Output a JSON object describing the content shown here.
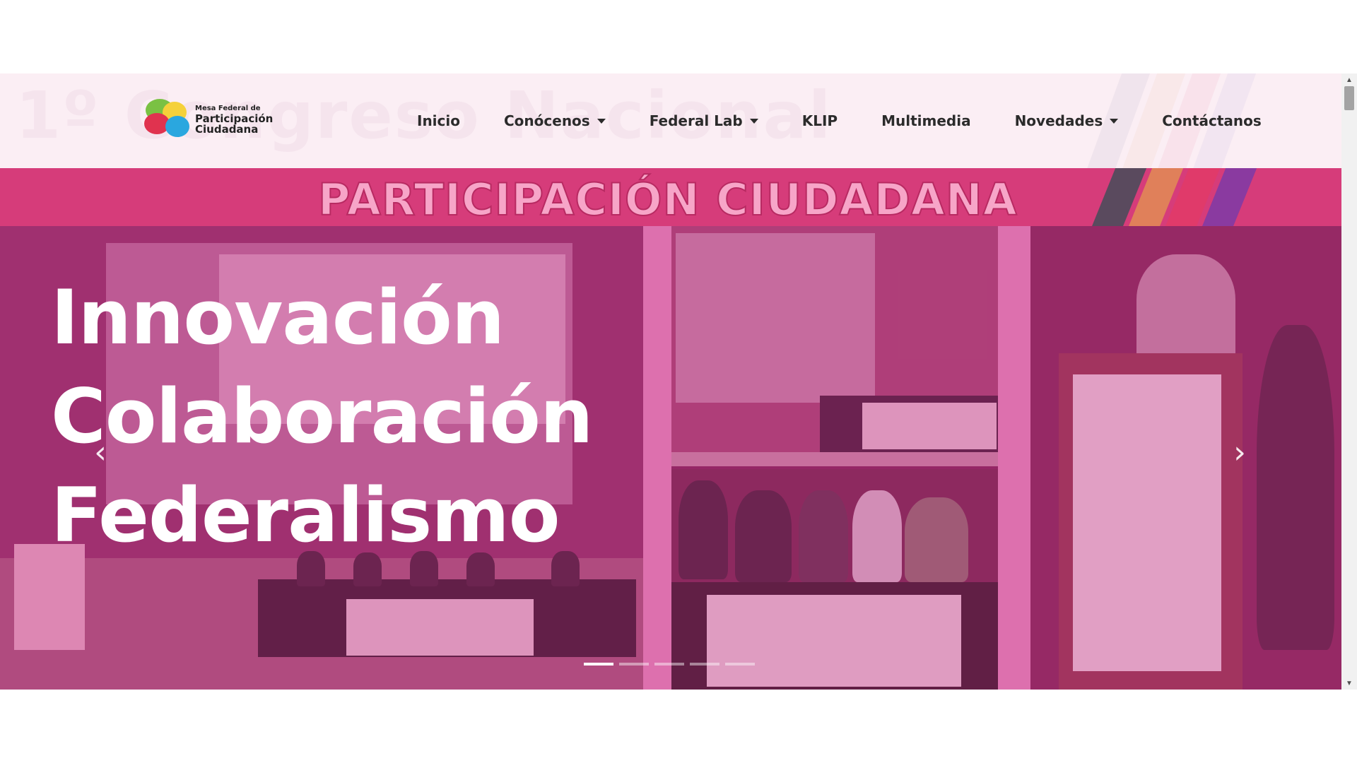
{
  "logo": {
    "line1": "Mesa Federal de",
    "line2": "Participación",
    "line3": "Ciudadana"
  },
  "header_ghost_text": "1º Congreso Nacional",
  "nav": {
    "items": [
      {
        "label": "Inicio",
        "dropdown": false
      },
      {
        "label": "Conócenos",
        "dropdown": true
      },
      {
        "label": "Federal Lab",
        "dropdown": true
      },
      {
        "label": "KLIP",
        "dropdown": false
      },
      {
        "label": "Multimedia",
        "dropdown": false
      },
      {
        "label": "Novedades",
        "dropdown": true
      },
      {
        "label": "Contáctanos",
        "dropdown": false
      }
    ]
  },
  "banner": {
    "title": "PARTICIPACIÓN CIUDADANA"
  },
  "carousel": {
    "headline": [
      "Innovación",
      "Colaboración",
      "Federalismo"
    ],
    "prev_icon": "chevron-left-icon",
    "next_icon": "chevron-right-icon",
    "indicator_count": 5,
    "active_index": 0
  },
  "colors": {
    "header_bg": "#fbeef4",
    "banner_bg": "#d63c7a",
    "banner_text": "#f7a5c8",
    "overlay": "#c83c8c",
    "nav_text": "#2b2b2b"
  }
}
